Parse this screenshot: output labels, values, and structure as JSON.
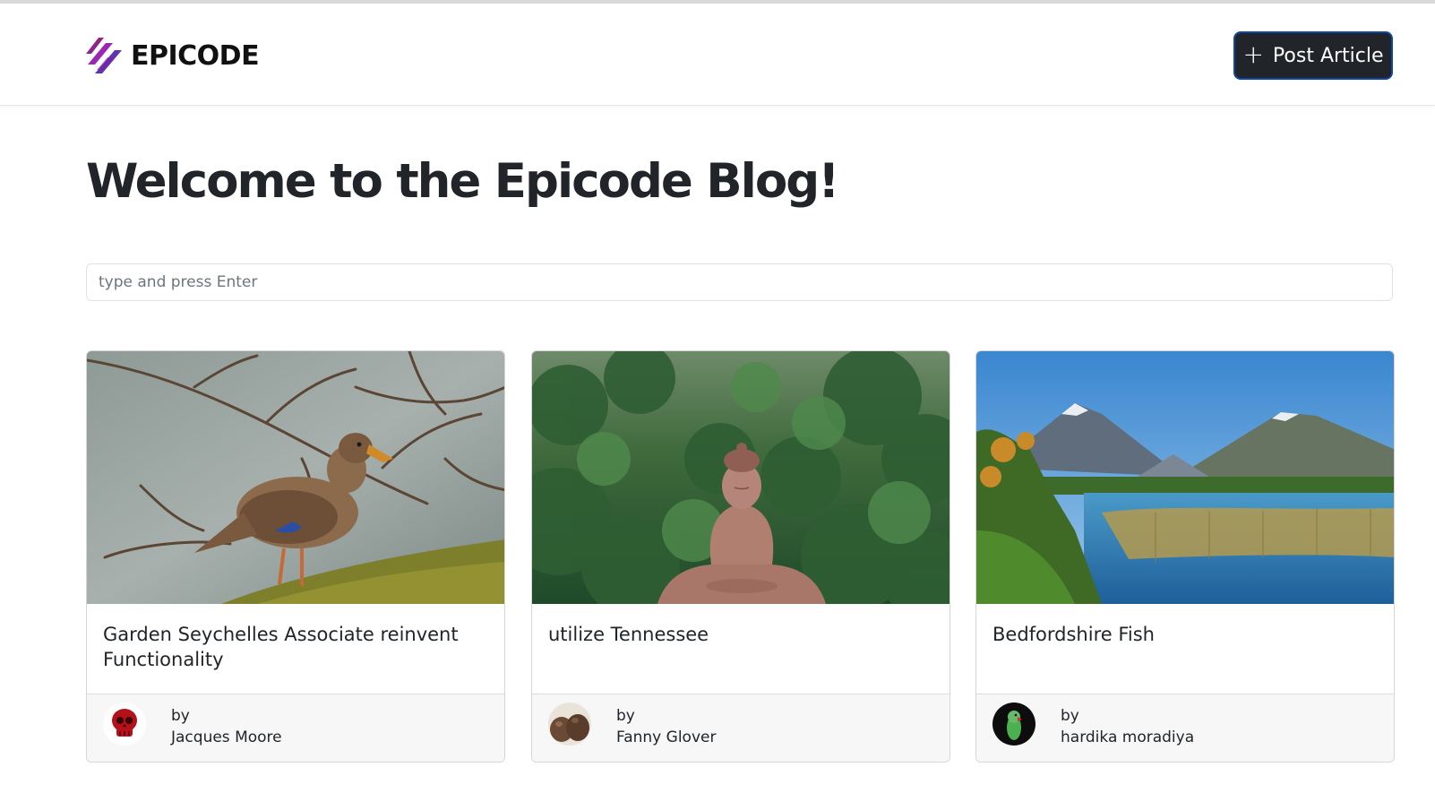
{
  "brand": {
    "name": "EPICODE",
    "icon": "epicode-logo-icon"
  },
  "navbar": {
    "post_button_label": "Post Article",
    "post_button_icon": "plus-icon"
  },
  "page": {
    "heading": "Welcome to the Epicode Blog!"
  },
  "search": {
    "placeholder": "type and press Enter",
    "value": ""
  },
  "colors": {
    "button_bg": "#212529",
    "button_border": "#0d47a1",
    "logo_purple": "#7b2ff7",
    "logo_magenta": "#c2185b"
  },
  "articles": [
    {
      "title": "Garden Seychelles Associate reinvent Functionality",
      "by_label": "by",
      "author": "Jacques Moore",
      "image": "duck-on-branch-photo",
      "avatar": "red-skull-avatar"
    },
    {
      "title": "utilize Tennessee",
      "by_label": "by",
      "author": "Fanny Glover",
      "image": "buddha-statue-forest-photo",
      "avatar": "brown-stones-avatar"
    },
    {
      "title": "Bedfordshire Fish",
      "by_label": "by",
      "author": "hardika moradiya",
      "image": "mountain-lake-photo",
      "avatar": "green-parrot-avatar"
    }
  ]
}
